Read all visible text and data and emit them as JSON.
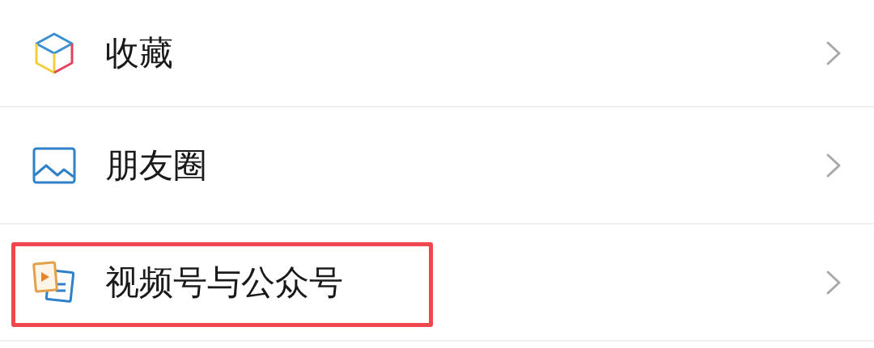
{
  "menu_items": [
    {
      "label": "收藏",
      "kind": "favorites",
      "highlighted": false
    },
    {
      "label": "朋友圈",
      "kind": "moments",
      "highlighted": false
    },
    {
      "label": "视频号与公众号",
      "kind": "channels",
      "highlighted": true
    }
  ]
}
